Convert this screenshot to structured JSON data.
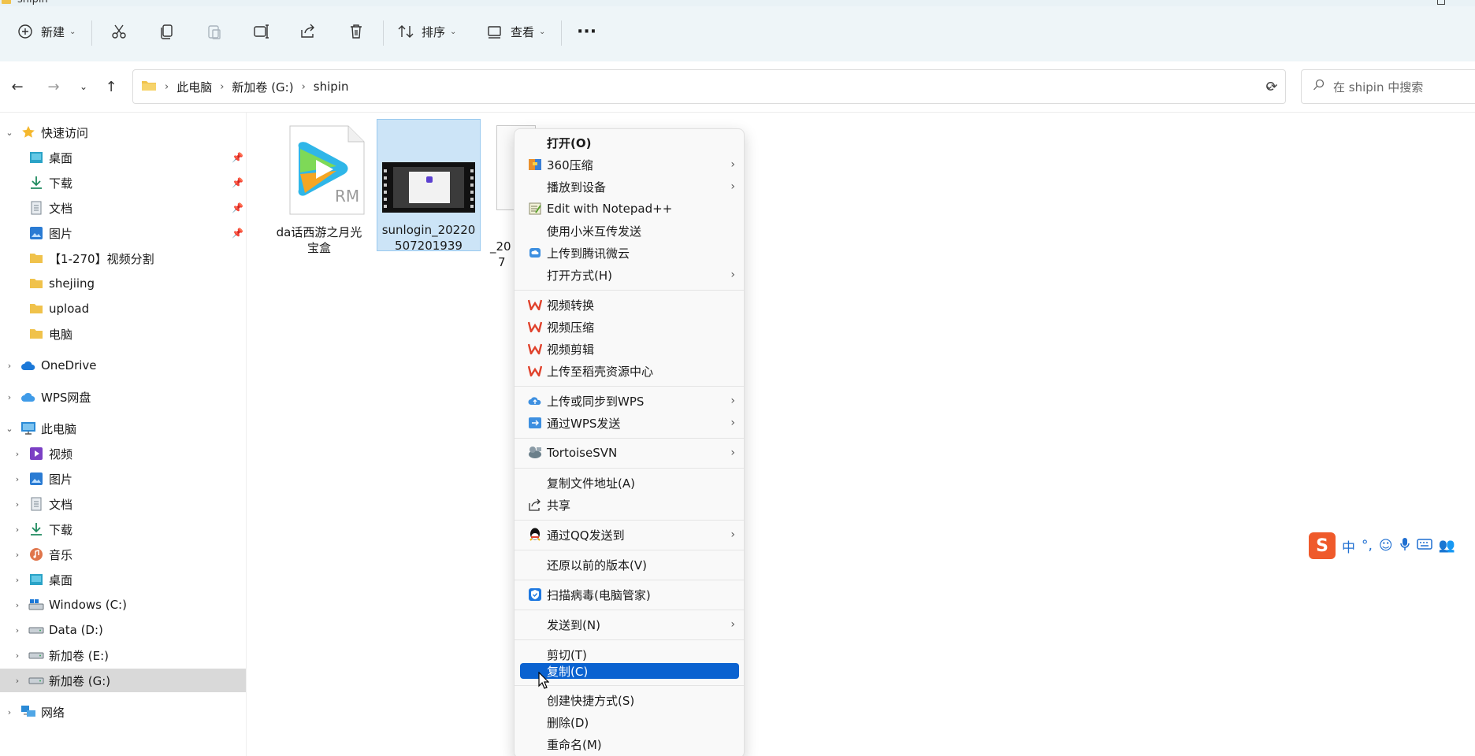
{
  "window": {
    "title": "shipin"
  },
  "toolbar": {
    "new_label": "新建",
    "sort_label": "排序",
    "view_label": "查看",
    "more_label": "···"
  },
  "address": {
    "crumbs": [
      "此电脑",
      "新加卷 (G:)",
      "shipin"
    ],
    "search_placeholder": "在 shipin 中搜索"
  },
  "sidebar": {
    "quick_access": "快速访问",
    "quick_items": [
      "桌面",
      "下载",
      "文档",
      "图片",
      "【1-270】视频分割",
      "shejiing",
      "upload",
      "电脑"
    ],
    "onedrive": "OneDrive",
    "wps": "WPS网盘",
    "this_pc": "此电脑",
    "pc_items": [
      "视频",
      "图片",
      "文档",
      "下载",
      "音乐",
      "桌面",
      "Windows (C:)",
      "Data (D:)",
      "新加卷 (E:)",
      "新加卷 (G:)"
    ],
    "network": "网络"
  },
  "files": [
    {
      "name_line1": "da话西游之月光",
      "name_line2": "宝盒",
      "badge": "RM"
    },
    {
      "name_line1": "sunlogin_20220",
      "name_line2": "507201939"
    },
    {
      "name_line1": "_20",
      "name_line2": "7"
    }
  ],
  "context_menu": {
    "items": [
      {
        "label": "打开(O)",
        "bold": true
      },
      {
        "label": "360压缩",
        "arrow": true
      },
      {
        "label": "播放到设备",
        "arrow": true
      },
      {
        "label": "Edit with Notepad++"
      },
      {
        "label": "使用小米互传发送"
      },
      {
        "label": "上传到腾讯微云"
      },
      {
        "label": "打开方式(H)",
        "arrow": true
      },
      {
        "label": "视频转换"
      },
      {
        "label": "视频压缩"
      },
      {
        "label": "视频剪辑"
      },
      {
        "label": "上传至稻壳资源中心"
      },
      {
        "label": "上传或同步到WPS",
        "arrow": true
      },
      {
        "label": "通过WPS发送",
        "arrow": true
      },
      {
        "label": "TortoiseSVN",
        "arrow": true
      },
      {
        "label": "复制文件地址(A)"
      },
      {
        "label": "共享"
      },
      {
        "label": "通过QQ发送到",
        "arrow": true
      },
      {
        "label": "还原以前的版本(V)"
      },
      {
        "label": "扫描病毒(电脑管家)"
      },
      {
        "label": "发送到(N)",
        "arrow": true
      },
      {
        "label": "剪切(T)"
      },
      {
        "label": "复制(C)",
        "highlighted": true
      },
      {
        "label": "创建快捷方式(S)"
      },
      {
        "label": "删除(D)"
      },
      {
        "label": "重命名(M)"
      }
    ]
  },
  "ime": {
    "mode": "中",
    "punct": "°,"
  },
  "colors": {
    "toolbar_bg": "#eef5f8",
    "selection": "#cce4f7",
    "menu_highlight": "#0a62d0",
    "wps_red": "#e0412b"
  }
}
